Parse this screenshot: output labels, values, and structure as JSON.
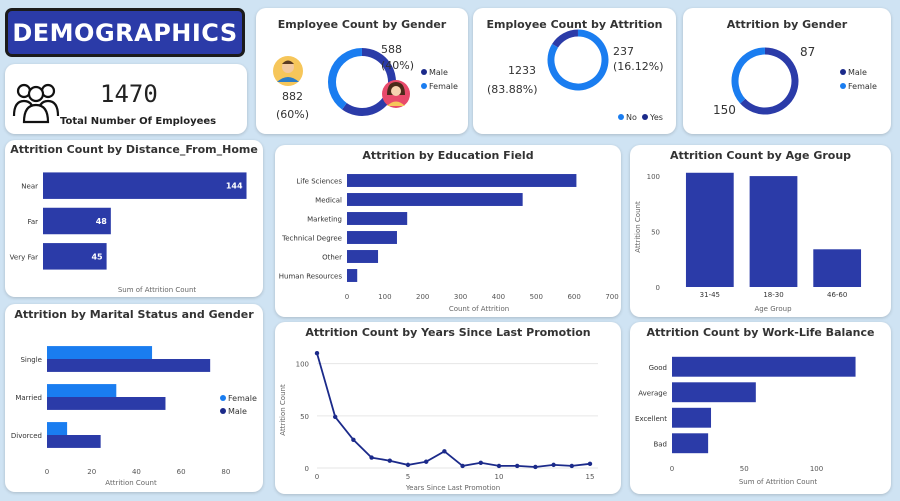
{
  "banner": {
    "title": "DEMOGRAPHICS"
  },
  "kpi": {
    "value": "1470",
    "label": "Total Number Of Employees"
  },
  "colors": {
    "dark": "#2b3ba8",
    "light": "#1a7df0",
    "navy": "#1b2a8a"
  },
  "icons": {
    "kpi": "people-group-icon",
    "male": "male-avatar-icon",
    "female": "female-avatar-icon"
  },
  "chart_data": [
    {
      "type": "pie",
      "title": "Employee Count by Gender",
      "donut": true,
      "slices": [
        {
          "label": "Male",
          "value": 882,
          "label_text": "882",
          "pct": "(60%)"
        },
        {
          "label": "Female",
          "value": 588,
          "label_text": "588",
          "pct": "(40%)"
        }
      ],
      "legend": [
        "Male",
        "Female"
      ],
      "legend_position": "right"
    },
    {
      "type": "pie",
      "title": "Employee Count by Attrition",
      "donut": true,
      "slices": [
        {
          "label": "No",
          "value": 1233,
          "label_text": "1233",
          "pct": "(83.88%)"
        },
        {
          "label": "Yes",
          "value": 237,
          "label_text": "237",
          "pct": "(16.12%)"
        }
      ],
      "legend": [
        "No",
        "Yes"
      ],
      "legend_position": "bottom-right"
    },
    {
      "type": "pie",
      "title": "Attrition by Gender",
      "donut": true,
      "slices": [
        {
          "label": "Male",
          "value": 150,
          "label_text": "150"
        },
        {
          "label": "Female",
          "value": 87,
          "label_text": "87"
        }
      ],
      "legend": [
        "Male",
        "Female"
      ],
      "legend_position": "right"
    },
    {
      "type": "bar",
      "orientation": "horizontal",
      "title": "Attrition Count by Distance_From_Home",
      "categories": [
        "Near",
        "Far",
        "Very Far"
      ],
      "values": [
        144,
        48,
        45
      ],
      "data_labels": [
        "144",
        "48",
        "45"
      ],
      "xlabel": "Sum of Attrition Count",
      "xlim": [
        0,
        150
      ]
    },
    {
      "type": "bar",
      "orientation": "horizontal",
      "title": "Attrition by Education Field",
      "categories": [
        "Life Sciences",
        "Medical",
        "Marketing",
        "Technical Degree",
        "Other",
        "Human Resources"
      ],
      "values": [
        606,
        464,
        159,
        132,
        82,
        27
      ],
      "xlabel": "Count of Attrition",
      "xticks": [
        "0",
        "100",
        "200",
        "300",
        "400",
        "500",
        "600",
        "700"
      ],
      "xlim": [
        0,
        700
      ]
    },
    {
      "type": "bar",
      "orientation": "vertical",
      "title": "Attrition Count by Age Group",
      "categories": [
        "31-45",
        "18-30",
        "46-60"
      ],
      "values": [
        103,
        100,
        34
      ],
      "xlabel": "Age Group",
      "ylabel": "Attrition Count",
      "yticks": [
        "0",
        "50",
        "100"
      ],
      "ylim": [
        0,
        110
      ]
    },
    {
      "type": "bar",
      "orientation": "horizontal",
      "title": "Attrition by Marital Status and Gender",
      "categories": [
        "Single",
        "Married",
        "Divorced"
      ],
      "series": [
        {
          "name": "Female",
          "values": [
            47,
            31,
            9
          ]
        },
        {
          "name": "Male",
          "values": [
            73,
            53,
            24
          ]
        }
      ],
      "xlabel": "Attrition Count",
      "xticks": [
        "0",
        "20",
        "40",
        "60",
        "80"
      ],
      "xlim": [
        0,
        85
      ],
      "legend": [
        "Female",
        "Male"
      ],
      "legend_position": "right"
    },
    {
      "type": "line",
      "title": "Attrition Count by Years Since Last Promotion",
      "x": [
        0,
        1,
        2,
        3,
        4,
        5,
        6,
        7,
        8,
        9,
        10,
        11,
        12,
        13,
        14,
        15
      ],
      "values": [
        110,
        49,
        27,
        10,
        7,
        3,
        6,
        16,
        2,
        5,
        2,
        2,
        1,
        3,
        2,
        4
      ],
      "xlabel": "Years Since Last Promotion",
      "ylabel": "Attrition Count",
      "xticks": [
        "0",
        "5",
        "10",
        "15"
      ],
      "yticks": [
        "0",
        "50",
        "100"
      ],
      "ylim": [
        0,
        115
      ],
      "xlim": [
        0,
        15
      ]
    },
    {
      "type": "bar",
      "orientation": "horizontal",
      "title": "Attrition Count by Work-Life Balance",
      "categories": [
        "Good",
        "Average",
        "Excellent",
        "Bad"
      ],
      "values": [
        127,
        58,
        27,
        25
      ],
      "xlabel": "Sum of Attrition Count",
      "xticks": [
        "0",
        "50",
        "100"
      ],
      "xlim": [
        0,
        137
      ]
    }
  ]
}
